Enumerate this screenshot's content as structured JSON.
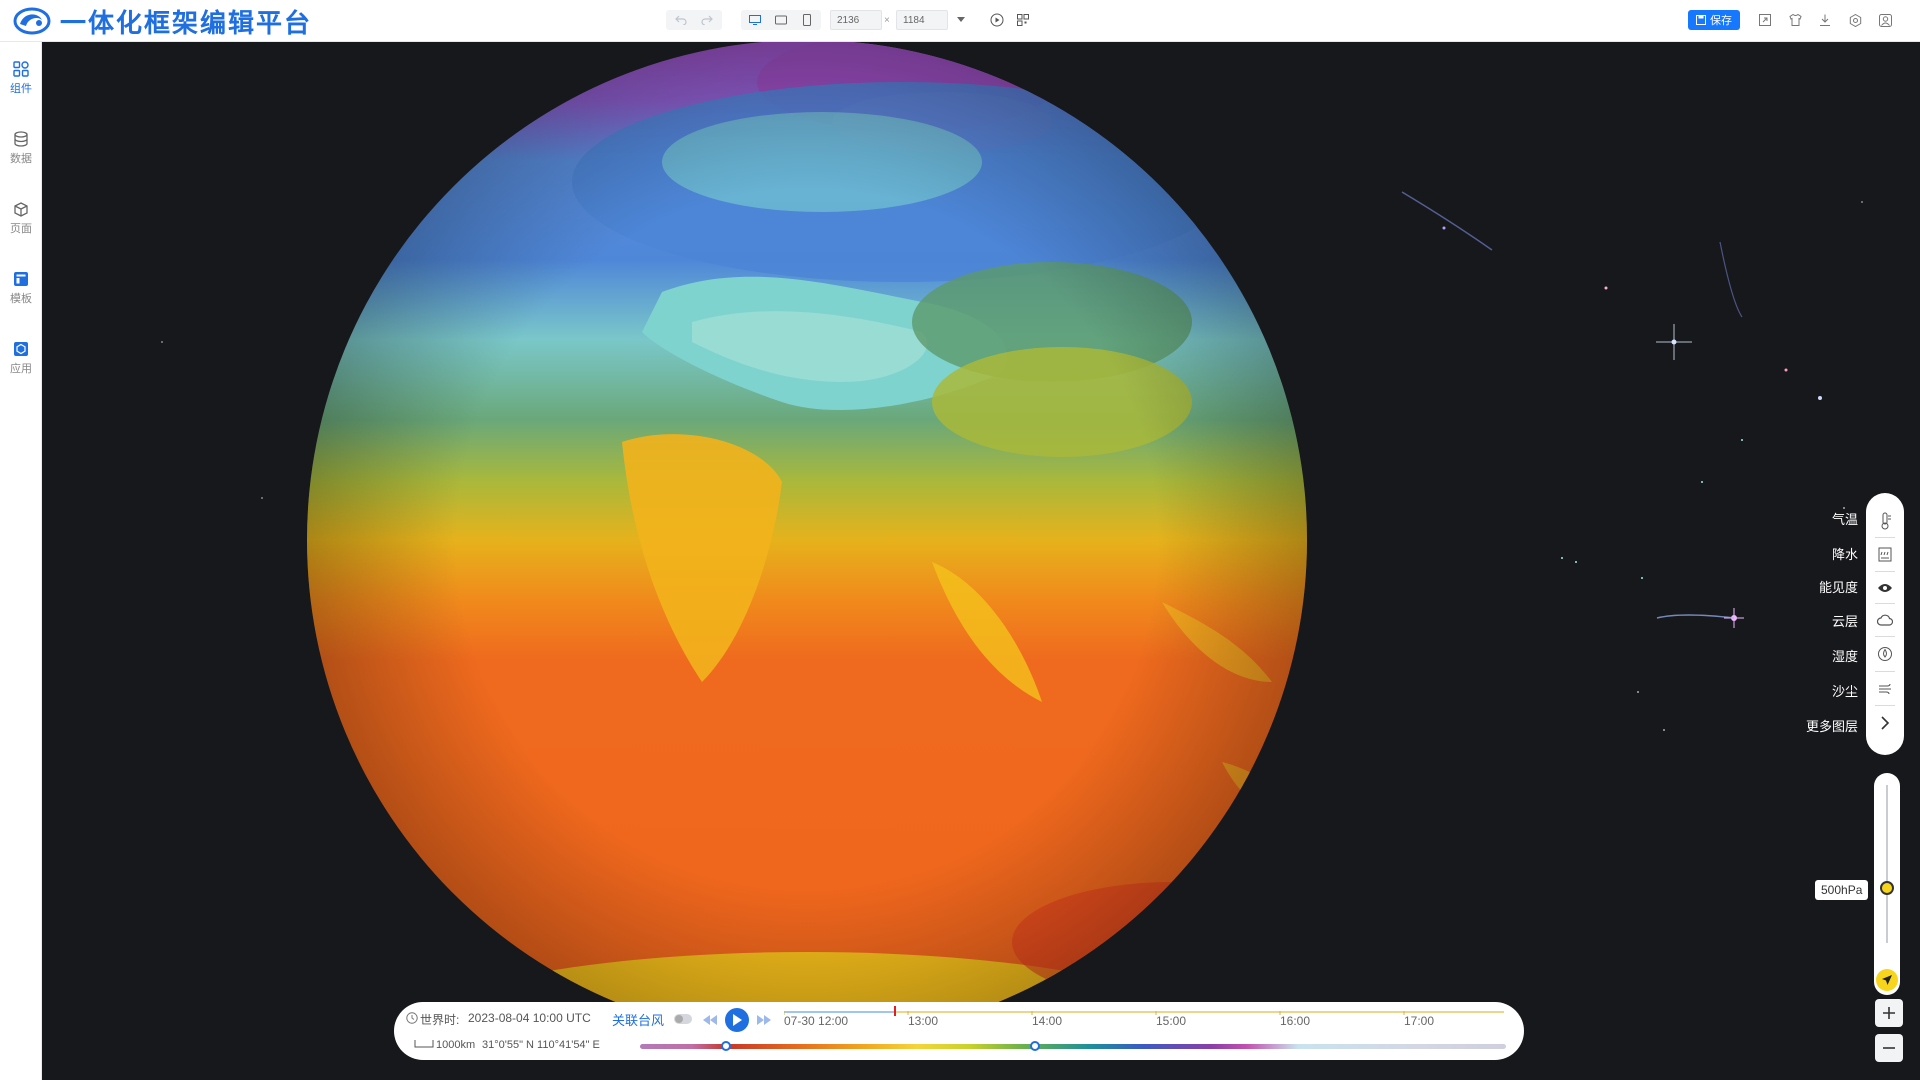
{
  "app": {
    "title": "一体化框架编辑平台"
  },
  "toolbar": {
    "width_value": "2136",
    "height_value": "1184",
    "times_symbol": "×",
    "save_label": "保存"
  },
  "sidebar": {
    "items": [
      {
        "label": "组件",
        "icon": "components-icon",
        "active": true
      },
      {
        "label": "数据",
        "icon": "database-icon",
        "active": false
      },
      {
        "label": "页面",
        "icon": "pages-icon",
        "active": false
      },
      {
        "label": "模板",
        "icon": "template-icon",
        "active": false
      },
      {
        "label": "应用",
        "icon": "app-icon",
        "active": false
      }
    ]
  },
  "layers": {
    "items": [
      {
        "label": "气温",
        "icon": "thermometer-icon"
      },
      {
        "label": "降水",
        "icon": "precipitation-icon"
      },
      {
        "label": "能见度",
        "icon": "eye-icon"
      },
      {
        "label": "云层",
        "icon": "cloud-icon"
      },
      {
        "label": "湿度",
        "icon": "humidity-icon"
      },
      {
        "label": "沙尘",
        "icon": "dust-icon"
      },
      {
        "label": "更多图层",
        "icon": "chevron-right-icon"
      }
    ]
  },
  "pressure": {
    "label": "500hPa"
  },
  "timeline": {
    "world_time_label": "世界时:",
    "world_time_value": "2023-08-04 10:00 UTC",
    "typhoon_label": "关联台风",
    "start_label": "07-30 12:00",
    "ticks": [
      "13:00",
      "14:00",
      "15:00",
      "16:00",
      "17:00"
    ],
    "scale_text": "1000km",
    "coords_text": "31°0'55\" N 110°41'54\" E"
  },
  "colors": {
    "brand": "#1f6fe0",
    "save": "#1677ff",
    "stage_bg": "#17181c",
    "accent_yellow": "#f7d51c"
  }
}
